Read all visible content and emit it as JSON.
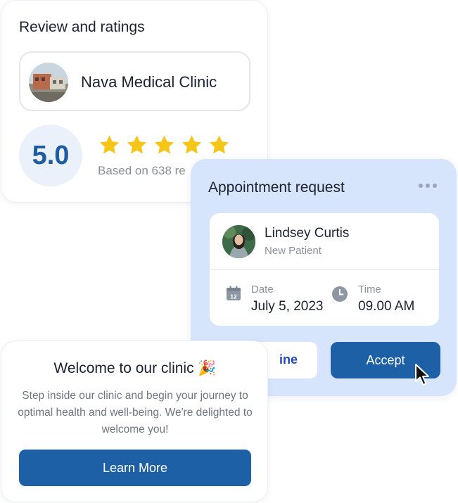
{
  "review": {
    "title": "Review and ratings",
    "clinic_name": "Nava Medical Clinic",
    "score": "5.0",
    "rating_stars": 5,
    "star_color": "#f5c518",
    "based_on": "Based on 638 re"
  },
  "appointment": {
    "title": "Appointment request",
    "menu_icon": "more-dots-icon",
    "patient": {
      "name": "Lindsey Curtis",
      "type": "New Patient"
    },
    "date_label": "Date",
    "date_icon": "calendar-icon",
    "calendar_day": "12",
    "date_value": "July 5, 2023",
    "time_label": "Time",
    "time_icon": "clock-icon",
    "time_value": "09.00 AM",
    "decline_label": "ine",
    "accept_label": "Accept",
    "background": "#d6e4fc"
  },
  "welcome": {
    "title": "Welcome to our clinic 🎉",
    "body": "Step inside our clinic and begin your journey to optimal health and well-being. We're delighted to welcome you!",
    "button_label": "Learn More"
  },
  "colors": {
    "primary_button": "#1e60a6",
    "score_text": "#1e5da0"
  }
}
